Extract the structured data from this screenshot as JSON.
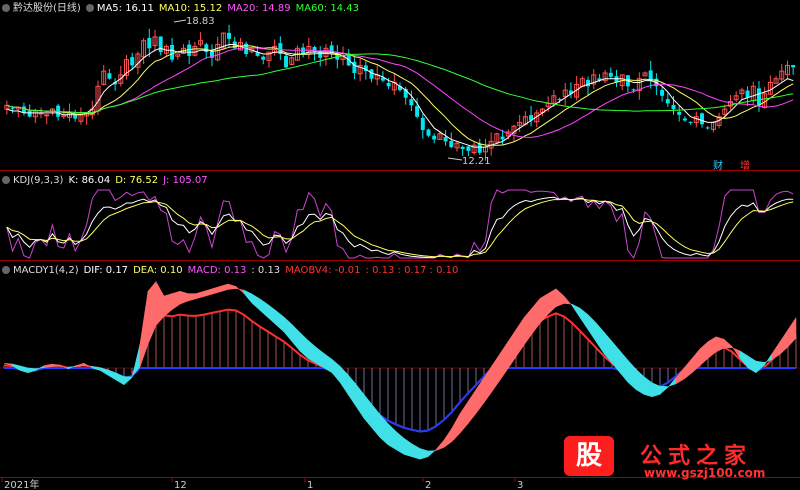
{
  "stock_panel": {
    "title": "黔达股份(日线)",
    "ma5": "MA5: 16.11",
    "ma10": "MA10: 15.12",
    "ma20": "MA20: 14.89",
    "ma60": "MA60: 14.43",
    "high_label": "18.83",
    "low_label": "12.21",
    "tag_cai": "财",
    "tag_zeng": "增"
  },
  "kdj_panel": {
    "title": "KDJ(9,3,3)",
    "k": "K: 86.04",
    "d": "D: 76.52",
    "j": "J: 105.07"
  },
  "macd_panel": {
    "title": "MACDY1(4,2)",
    "dif": "DIF: 0.17",
    "dea": "DEA: 0.10",
    "macd": "MACD: 0.13",
    "macd_extra": ": 0.13",
    "maobv": "MAOBV4: -0.01",
    "maobv_vals": ": 0.13  : 0.17  : 0.10"
  },
  "x_axis": {
    "labels": [
      "2021年",
      "12",
      "1",
      "2",
      "3"
    ]
  },
  "watermark": {
    "stock_char": "股",
    "site_title": "公式之家",
    "site_url": "www.gszj100.com"
  },
  "colors": {
    "background": "#000000",
    "up": "#ff5050",
    "down": "#00e5ee",
    "ma5": "#ffffff",
    "ma10": "#ffff66",
    "ma20": "#ff44ff",
    "ma60": "#33ff33",
    "macd_red": "#ff3030",
    "macd_blue": "#1e3cff",
    "ribbon_red": "#ff6a6a",
    "ribbon_cyan": "#40e0e8"
  },
  "chart_data": [
    {
      "type": "candlestick",
      "title": "黔达股份(日线)",
      "price_range": [
        11.5,
        19.5
      ],
      "annotations": {
        "high": 18.83,
        "low": 12.21
      },
      "series_values": {
        "MA5": 16.11,
        "MA10": 15.12,
        "MA20": 14.89,
        "MA60": 14.43
      },
      "close_path": [
        14.8,
        14.6,
        14.7,
        14.4,
        14.2,
        14.5,
        14.4,
        14.3,
        14.6,
        14.2,
        14.3,
        14.4,
        14.1,
        14.3,
        14.4,
        14.6,
        15.8,
        16.6,
        16.2,
        15.9,
        16.4,
        17.2,
        16.9,
        17.5,
        18.2,
        17.8,
        18.4,
        17.6,
        17.9,
        17.2,
        17.5,
        17.8,
        17.4,
        17.9,
        18.2,
        17.6,
        17.3,
        18.0,
        18.6,
        18.3,
        17.8,
        18.1,
        17.5,
        17.8,
        17.4,
        17.2,
        17.6,
        17.9,
        17.5,
        16.8,
        17.3,
        17.8,
        17.5,
        17.9,
        17.6,
        17.3,
        17.8,
        17.5,
        17.2,
        17.4,
        16.9,
        16.5,
        16.9,
        16.6,
        16.2,
        16.4,
        16.1,
        15.8,
        16.0,
        15.6,
        15.2,
        14.8,
        14.2,
        13.5,
        13.2,
        13.0,
        13.3,
        12.9,
        12.6,
        12.8,
        12.5,
        12.4,
        12.7,
        12.3,
        12.6,
        12.9,
        13.3,
        13.0,
        13.4,
        13.7,
        13.9,
        14.2,
        14.0,
        14.4,
        14.6,
        14.9,
        15.3,
        15.1,
        15.6,
        15.4,
        15.9,
        16.2,
        15.8,
        16.4,
        16.1,
        16.5,
        16.3,
        16.0,
        16.4,
        15.8,
        15.6,
        16.2,
        16.5,
        16.1,
        15.8,
        15.3,
        14.9,
        14.6,
        14.3,
        14.0,
        13.9,
        14.2,
        13.8,
        13.6,
        13.9,
        14.2,
        14.6,
        15.0,
        15.3,
        15.6,
        15.2,
        15.8,
        14.8,
        15.4,
        16.0,
        16.2,
        16.6,
        16.9,
        16.8
      ],
      "ma_paths": {
        "MA5": [
          14.6,
          14.5,
          14.5,
          14.4,
          14.4,
          14.4,
          14.4,
          14.4,
          14.4,
          14.4,
          14.3,
          14.3,
          14.3,
          14.3,
          14.4,
          14.6,
          15.0,
          15.5,
          15.8,
          16.0,
          16.2,
          16.5,
          16.7,
          17.0,
          17.3,
          17.5,
          17.7,
          17.8,
          17.7,
          17.7,
          17.6,
          17.6,
          17.6,
          17.6,
          17.7,
          17.7,
          17.7,
          17.8,
          17.9,
          18.0,
          18.0,
          17.9,
          17.8,
          17.7,
          17.6,
          17.5,
          17.5,
          17.6,
          17.6,
          17.5,
          17.4,
          17.5,
          17.5,
          17.6,
          17.6,
          17.6,
          17.6,
          17.6,
          17.5,
          17.4,
          17.2,
          16.9,
          16.8,
          16.7,
          16.5,
          16.4,
          16.3,
          16.1,
          16.0,
          15.8,
          15.6,
          15.3,
          14.9,
          14.4,
          14.0,
          13.6,
          13.4,
          13.2,
          13.0,
          12.9,
          12.8,
          12.7,
          12.6,
          12.6,
          12.6,
          12.7,
          12.8,
          12.9,
          13.1,
          13.4,
          13.6,
          13.8,
          14.0,
          14.2,
          14.4,
          14.6,
          14.8,
          15.0,
          15.2,
          15.4,
          15.6,
          15.8,
          15.9,
          16.0,
          16.1,
          16.2,
          16.2,
          16.2,
          16.2,
          16.1,
          16.0,
          16.0,
          16.1,
          16.1,
          16.0,
          15.8,
          15.5,
          15.1,
          14.8,
          14.5,
          14.2,
          14.1,
          14.0,
          13.9,
          13.9,
          14.0,
          14.2,
          14.5,
          14.8,
          15.1,
          15.2,
          15.3,
          15.4,
          15.5,
          15.6,
          15.8,
          16.0,
          16.2,
          16.1
        ]
      }
    },
    {
      "type": "line",
      "title": "KDJ(9,3,3)",
      "series": [
        {
          "name": "K",
          "last": 86.04
        },
        {
          "name": "D",
          "last": 76.52
        },
        {
          "name": "J",
          "last": 105.07
        }
      ],
      "ylim": [
        0,
        110
      ]
    },
    {
      "type": "area",
      "title": "MACDY1(4,2)",
      "values": {
        "DIF": 0.17,
        "DEA": 0.1,
        "MACD": 0.13,
        "MAOBV4": -0.01
      },
      "dif_path": [
        0.1,
        0.05,
        -0.05,
        -0.1,
        -0.05,
        0.05,
        0.08,
        0.06,
        -0.02,
        0.05,
        0.1,
        0.0,
        -0.05,
        -0.15,
        -0.25,
        -0.35,
        -0.2,
        0.5,
        1.6,
        1.8,
        1.5,
        1.55,
        1.6,
        1.55,
        1.55,
        1.6,
        1.65,
        1.7,
        1.75,
        1.7,
        1.55,
        1.35,
        1.2,
        1.05,
        0.9,
        0.75,
        0.55,
        0.35,
        0.2,
        0.1,
        0.0,
        -0.1,
        -0.3,
        -0.55,
        -0.8,
        -1.05,
        -1.25,
        -1.45,
        -1.6,
        -1.7,
        -1.8,
        -1.85,
        -1.9,
        -1.85,
        -1.7,
        -1.5,
        -1.25,
        -0.95,
        -0.7,
        -0.45,
        -0.2,
        0.05,
        0.3,
        0.55,
        0.8,
        1.05,
        1.25,
        1.45,
        1.55,
        1.65,
        1.5,
        1.3,
        1.05,
        0.8,
        0.55,
        0.3,
        0.1,
        -0.1,
        -0.3,
        -0.45,
        -0.55,
        -0.6,
        -0.55,
        -0.4,
        -0.2,
        0.0,
        0.2,
        0.4,
        0.55,
        0.65,
        0.6,
        0.45,
        0.2,
        0.0,
        -0.1,
        0.05,
        0.3,
        0.55,
        0.8,
        1.05
      ]
    }
  ]
}
